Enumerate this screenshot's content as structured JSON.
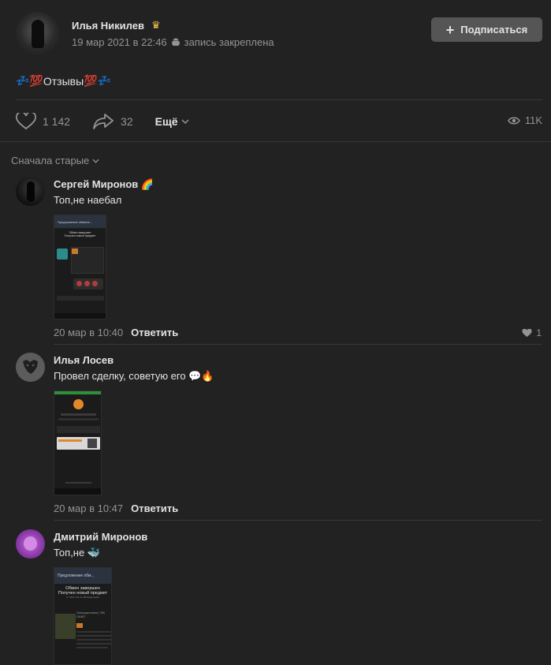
{
  "post": {
    "author": "Илья Никилев",
    "author_badge_icon": "crown-icon",
    "date": "19 мар 2021 в 22:46",
    "pinned_text": "запись закреплена",
    "subscribe_label": "Подписаться",
    "text": "Отзывы",
    "text_emoji_left": "💤💯",
    "text_emoji_right": "💯💤",
    "likes": "1 142",
    "shares": "32",
    "more_label": "Ещё",
    "views": "11K"
  },
  "sort_label": "Сначала старые",
  "comments": [
    {
      "name": "Сергей Миронов",
      "name_badge": "🌈",
      "text": "Топ,не наебал",
      "date": "20 мар в 10:40",
      "reply_label": "Ответить",
      "likes": "1"
    },
    {
      "name": "Илья Лосев",
      "text": "Провел сделку, советую его",
      "text_emoji": "💬🔥",
      "date": "20 мар в 10:47",
      "reply_label": "Ответить"
    },
    {
      "name": "Дмитрий Миронов",
      "text": "Топ,не",
      "text_emoji": "🐳"
    }
  ],
  "screenshot_texts": {
    "s1_header": "Предложение обмена...",
    "s1_title": "Обмен завершен",
    "s1_sub": "Получен новый предмет",
    "s3_header": "Предложение обм...",
    "s3_title": "Обмен завершен",
    "s3_sub": "Получен новый предмет",
    "s3_link": "от https://vk.com/lbrasjupnigki4",
    "s3_item": "Операционник | ФБ",
    "s3_item2": "ОАМТ"
  },
  "colors": {
    "background": "#222222",
    "text_primary": "#e1e3e6",
    "text_secondary": "#939393",
    "button": "#555555"
  }
}
